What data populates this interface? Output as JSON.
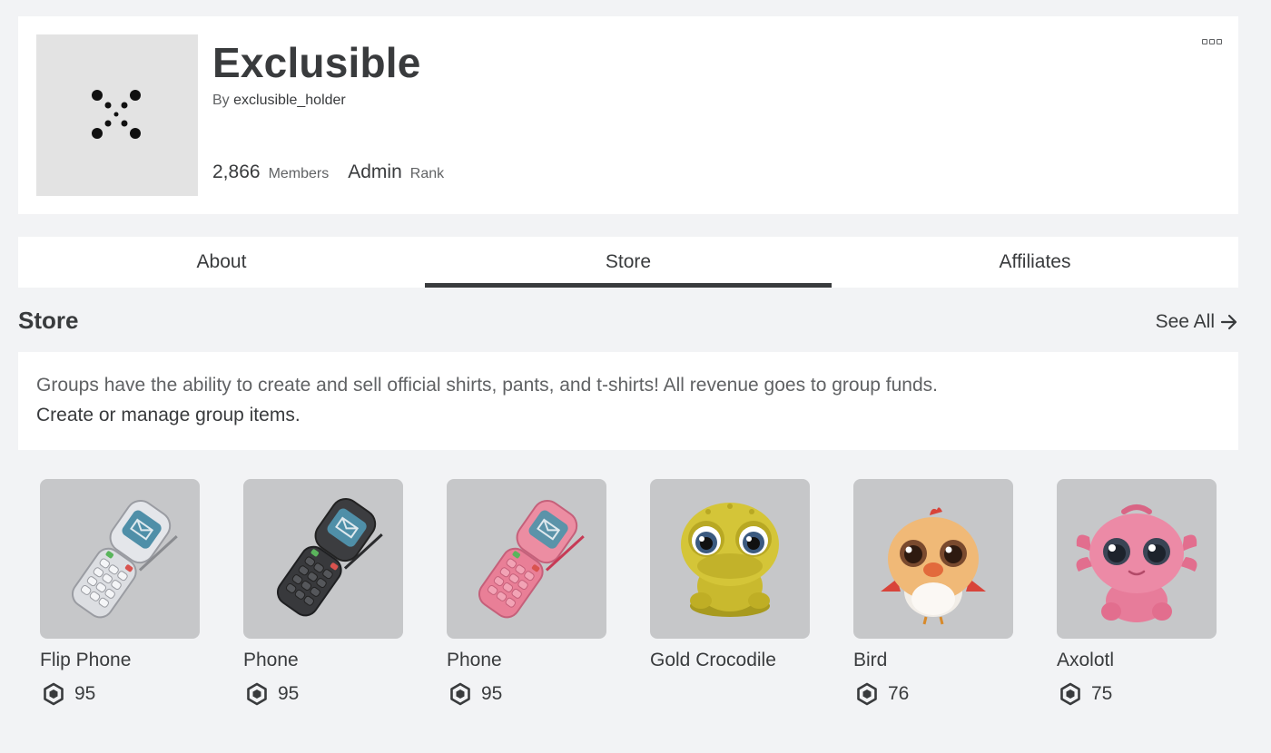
{
  "group": {
    "name": "Exclusible",
    "by_label": "By",
    "owner": "exclusible_holder",
    "members_count": "2,866",
    "members_label": "Members",
    "rank_value": "Admin",
    "rank_label": "Rank"
  },
  "tabs": [
    {
      "label": "About",
      "active": false
    },
    {
      "label": "Store",
      "active": true
    },
    {
      "label": "Affiliates",
      "active": false
    }
  ],
  "store": {
    "title": "Store",
    "see_all": "See All",
    "info_text": "Groups have the ability to create and sell official shirts, pants, and t-shirts! All revenue goes to group funds.",
    "manage_link": "Create or manage group items."
  },
  "items": [
    {
      "name": "Flip Phone",
      "price": "95",
      "icon": "flip-phone-silver"
    },
    {
      "name": "Phone",
      "price": "95",
      "icon": "flip-phone-black"
    },
    {
      "name": "Phone",
      "price": "95",
      "icon": "flip-phone-pink"
    },
    {
      "name": "Gold Crocodile",
      "price": "",
      "icon": "gold-crocodile"
    },
    {
      "name": "Bird",
      "price": "76",
      "icon": "bird"
    },
    {
      "name": "Axolotl",
      "price": "75",
      "icon": "axolotl"
    }
  ],
  "colors": {
    "background": "#f2f3f5",
    "card": "#ffffff",
    "text": "#393b3d",
    "muted": "#606264",
    "thumb": "#c6c7c9"
  }
}
